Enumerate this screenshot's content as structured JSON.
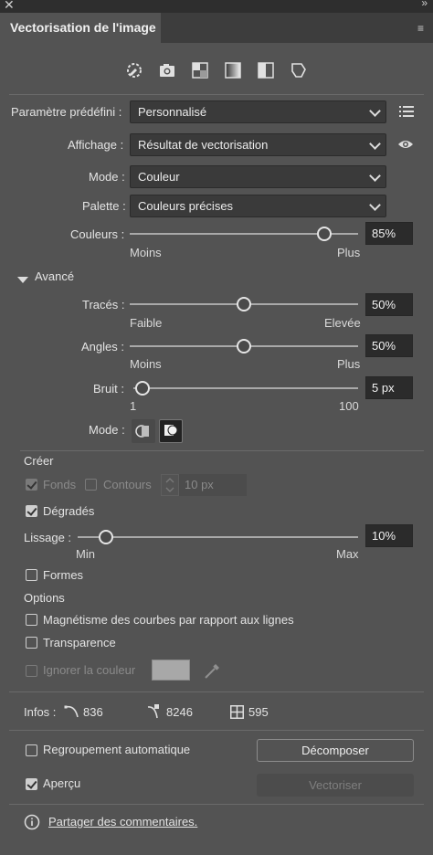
{
  "window": {
    "close_glyph": "✕",
    "collapse_glyph": "»"
  },
  "panel": {
    "title": "Vectorisation de l'image",
    "menu_glyph": "≡"
  },
  "presets": {
    "icons": [
      "auto-color-icon",
      "high-color-icon",
      "low-color-icon",
      "grayscale-icon",
      "black-white-icon",
      "outline-icon"
    ]
  },
  "preset_row": {
    "label": "Paramètre prédéfini :",
    "value": "Personnalisé"
  },
  "view_row": {
    "label": "Affichage :",
    "value": "Résultat de vectorisation"
  },
  "mode_row": {
    "label": "Mode :",
    "value": "Couleur"
  },
  "palette_row": {
    "label": "Palette :",
    "value": "Couleurs précises"
  },
  "colors_row": {
    "label": "Couleurs :",
    "value": "85%",
    "level": 0.85,
    "min": "Moins",
    "max": "Plus"
  },
  "advanced": {
    "label": "Avancé"
  },
  "paths_row": {
    "label": "Tracés :",
    "value": "50%",
    "level": 0.5,
    "min": "Faible",
    "max": "Elevée"
  },
  "angles_row": {
    "label": "Angles :",
    "value": "50%",
    "level": 0.5,
    "min": "Moins",
    "max": "Plus"
  },
  "noise_row": {
    "label": "Bruit :",
    "value": "5 px",
    "level": 0.04,
    "min": "1",
    "max": "100"
  },
  "method_row": {
    "label": "Mode :"
  },
  "create": {
    "label": "Créer",
    "fills": "Fonds",
    "strokes": "Contours",
    "stroke_value": "10 px",
    "gradients": "Dégradés"
  },
  "smooth_row": {
    "label": "Lissage :",
    "value": "10%",
    "level": 0.1,
    "min": "Min",
    "max": "Max"
  },
  "shapes": {
    "label": "Formes"
  },
  "options": {
    "label": "Options",
    "snap": "Magnétisme des courbes par rapport aux lignes",
    "transparency": "Transparence",
    "ignore": "Ignorer la couleur"
  },
  "info": {
    "label": "Infos :",
    "paths": "836",
    "anchors": "8246",
    "colors": "595"
  },
  "group": {
    "label": "Regroupement automatique",
    "expand": "Décomposer"
  },
  "preview": {
    "label": "Aperçu",
    "trace": "Vectoriser"
  },
  "feedback": {
    "label": "Partager des commentaires."
  }
}
